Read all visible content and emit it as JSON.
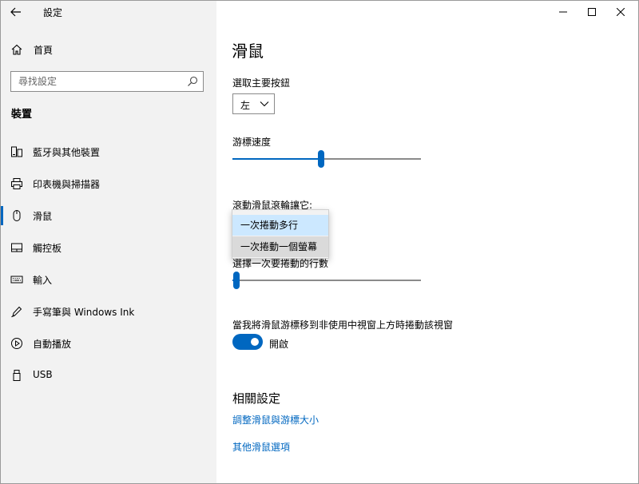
{
  "window": {
    "title": "設定"
  },
  "sidebar": {
    "home_label": "首頁",
    "search_placeholder": "尋找設定",
    "section_heading": "裝置",
    "items": [
      {
        "label": "藍牙與其他裝置",
        "icon": "bluetooth-devices-icon"
      },
      {
        "label": "印表機與掃描器",
        "icon": "printer-icon"
      },
      {
        "label": "滑鼠",
        "icon": "mouse-icon",
        "selected": true
      },
      {
        "label": "觸控板",
        "icon": "touchpad-icon"
      },
      {
        "label": "輸入",
        "icon": "keyboard-icon"
      },
      {
        "label": "手寫筆與 Windows Ink",
        "icon": "pen-icon"
      },
      {
        "label": "自動播放",
        "icon": "autoplay-icon"
      },
      {
        "label": "USB",
        "icon": "usb-icon"
      }
    ]
  },
  "main": {
    "page_title": "滑鼠",
    "primary_button_label": "選取主要按鈕",
    "primary_button_value": "左",
    "cursor_speed_label": "游標速度",
    "cursor_speed_level": 0.47,
    "wheel_scroll_label": "滾動滑鼠滾輪讓它:",
    "wheel_scroll_options": [
      "一次捲動多行",
      "一次捲動一個螢幕"
    ],
    "wheel_scroll_selected": "一次捲動多行",
    "lines_to_scroll_label": "選擇一次要捲動的行數",
    "lines_to_scroll_level": 0.02,
    "inactive_scroll_label": "當我將滑鼠游標移到非使用中視窗上方時捲動該視窗",
    "inactive_scroll_state": "開啟",
    "related_heading": "相關設定",
    "links": [
      "調整滑鼠與游標大小",
      "其他滑鼠選項"
    ]
  },
  "colors": {
    "accent": "#0067c0",
    "sidebar_bg": "#f2f2f2",
    "selected_option_bg": "#cce8ff"
  }
}
